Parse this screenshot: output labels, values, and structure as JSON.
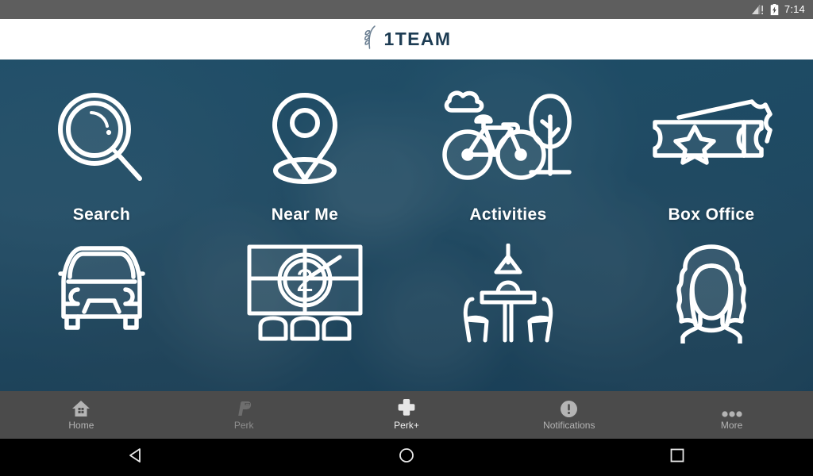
{
  "status_bar": {
    "time": "7:14",
    "signal_icon": "signal-warning-icon",
    "battery_icon": "battery-charging-icon"
  },
  "header": {
    "logo_mark": "wheat-stalk-logo-icon",
    "logo_text": "1TEAM",
    "logo_color": "#1d3c53",
    "background": "#ffffff"
  },
  "hero": {
    "tint_color": "#164864",
    "background_photo": "people-high-fiving-photo",
    "tiles": [
      {
        "label": "Search",
        "icon": "magnifier-icon"
      },
      {
        "label": "Near Me",
        "icon": "map-pin-icon"
      },
      {
        "label": "Activities",
        "icon": "bicycle-tree-cloud-icon"
      },
      {
        "label": "Box Office",
        "icon": "ticket-star-icon"
      },
      {
        "label": "",
        "icon": "car-front-icon"
      },
      {
        "label": "",
        "icon": "cinema-screen-seats-icon"
      },
      {
        "label": "",
        "icon": "dining-table-chairs-icon"
      },
      {
        "label": "",
        "icon": "person-avatar-icon"
      }
    ]
  },
  "tab_bar": {
    "background": "#4b4b4b",
    "items": [
      {
        "label": "Home",
        "icon": "home-icon",
        "state": "normal"
      },
      {
        "label": "Perk",
        "icon": "perk-p-icon",
        "state": "dim"
      },
      {
        "label": "Perk+",
        "icon": "plus-icon",
        "state": "active"
      },
      {
        "label": "Notifications",
        "icon": "exclamation-circle-icon",
        "state": "normal"
      },
      {
        "label": "More",
        "icon": "ellipsis-icon",
        "state": "normal"
      }
    ]
  },
  "nav_bar": {
    "background": "#000000",
    "buttons": [
      {
        "name": "back",
        "icon": "triangle-left-icon"
      },
      {
        "name": "home",
        "icon": "circle-icon"
      },
      {
        "name": "recents",
        "icon": "square-icon"
      }
    ]
  }
}
